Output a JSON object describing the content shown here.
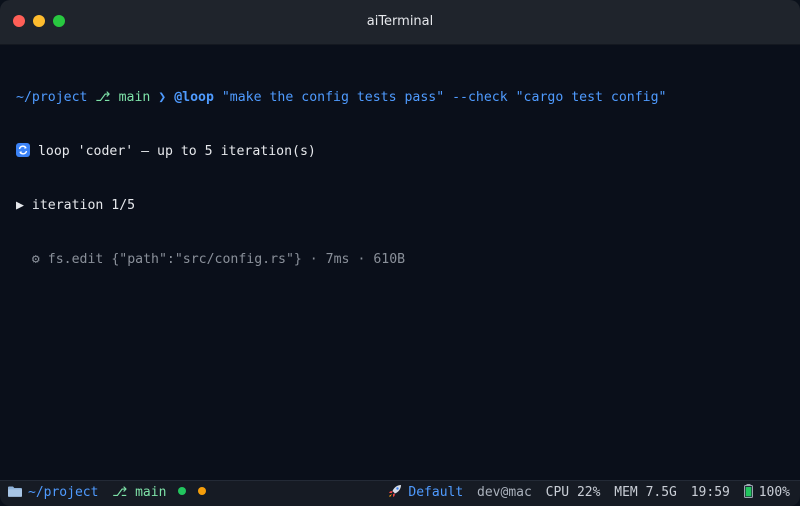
{
  "window": {
    "title": "aiTerminal",
    "traffic_colors": {
      "close": "#ff5f57",
      "minimize": "#febc2e",
      "maximize": "#28c840"
    }
  },
  "terminal": {
    "prompt_path": "~/project",
    "prompt_branch_symbol": "⎇",
    "prompt_branch": "main",
    "prompt_arrow": "❯",
    "command": "@loop",
    "command_args": "\"make the config tests pass\" --check \"cargo test config\"",
    "loop_line": "loop 'coder' — up to 5 iteration(s)",
    "iteration_marker": "▶",
    "iteration_line": "iteration 1/5",
    "tool_icon": "⚙",
    "tool_line": "fs.edit {\"path\":\"src/config.rs\"} · 7ms · 610B"
  },
  "statusbar": {
    "path": "~/project",
    "branch_symbol": "⎇",
    "branch": "main",
    "dot_colors": [
      "#22c55e",
      "#f59e0b"
    ],
    "profile": "Default",
    "user_host": "dev@mac",
    "cpu_label": "CPU",
    "cpu_value": "22%",
    "mem_label": "MEM",
    "mem_value": "7.5G",
    "time": "19:59",
    "battery": "100%"
  },
  "colors": {
    "accent": "#4f9bff",
    "branch": "#7ee2a8",
    "background": "#0a0f1a"
  }
}
